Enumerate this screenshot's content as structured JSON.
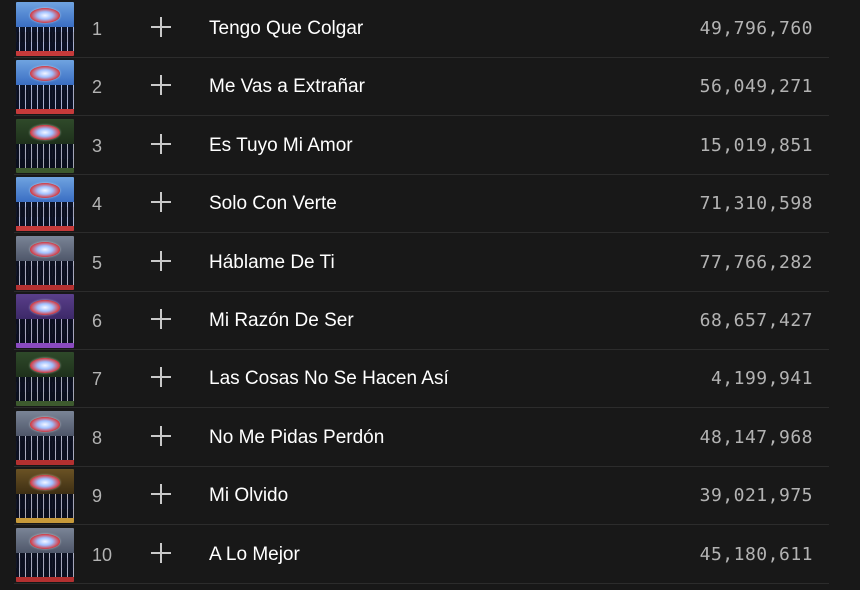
{
  "tracks": [
    {
      "number": "1",
      "title": "Tengo Que Colgar",
      "plays": "49,796,760",
      "cover": "blue"
    },
    {
      "number": "2",
      "title": "Me Vas a Extrañar",
      "plays": "56,049,271",
      "cover": "blue"
    },
    {
      "number": "3",
      "title": "Es Tuyo Mi Amor",
      "plays": "15,019,851",
      "cover": "green"
    },
    {
      "number": "4",
      "title": "Solo Con Verte",
      "plays": "71,310,598",
      "cover": "blue"
    },
    {
      "number": "5",
      "title": "Háblame De Ti",
      "plays": "77,766,282",
      "cover": "grey"
    },
    {
      "number": "6",
      "title": "Mi Razón De Ser",
      "plays": "68,657,427",
      "cover": "purple"
    },
    {
      "number": "7",
      "title": "Las Cosas No Se Hacen Así",
      "plays": "4,199,941",
      "cover": "green"
    },
    {
      "number": "8",
      "title": "No Me Pidas Perdón",
      "plays": "48,147,968",
      "cover": "grey"
    },
    {
      "number": "9",
      "title": "Mi Olvido",
      "plays": "39,021,975",
      "cover": "gold"
    },
    {
      "number": "10",
      "title": "A Lo Mejor",
      "plays": "45,180,611",
      "cover": "grey"
    }
  ],
  "icons": {
    "add": "plus-icon",
    "cover": "album-cover"
  },
  "colors": {
    "background": "#181818",
    "title_text": "#ffffff",
    "secondary_text": "#b3b3b3",
    "divider": "#2c2c2c"
  }
}
